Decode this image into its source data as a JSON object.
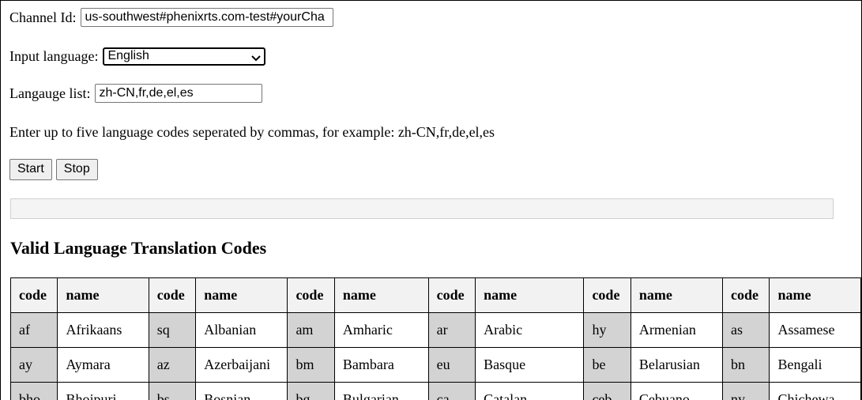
{
  "form": {
    "channel_label": "Channel Id:",
    "channel_value": "us-southwest#phenixrts.com-test#yourCha",
    "input_language_label": "Input language:",
    "input_language_selected": "English",
    "language_list_label": "Langauge list:",
    "language_list_value": "zh-CN,fr,de,el,es",
    "help_text": "Enter up to five language codes seperated by commas, for example: zh-CN,fr,de,el,es",
    "start_label": "Start",
    "stop_label": "Stop"
  },
  "section": {
    "title": "Valid Language Translation Codes"
  },
  "table": {
    "headers": [
      "code",
      "name",
      "code",
      "name",
      "code",
      "name",
      "code",
      "name",
      "code",
      "name",
      "code",
      "name"
    ],
    "rows": [
      [
        {
          "code": "af",
          "name": "Afrikaans"
        },
        {
          "code": "sq",
          "name": "Albanian"
        },
        {
          "code": "am",
          "name": "Amharic"
        },
        {
          "code": "ar",
          "name": "Arabic"
        },
        {
          "code": "hy",
          "name": "Armenian"
        },
        {
          "code": "as",
          "name": "Assamese"
        }
      ],
      [
        {
          "code": "ay",
          "name": "Aymara"
        },
        {
          "code": "az",
          "name": "Azerbaijani"
        },
        {
          "code": "bm",
          "name": "Bambara"
        },
        {
          "code": "eu",
          "name": "Basque"
        },
        {
          "code": "be",
          "name": "Belarusian"
        },
        {
          "code": "bn",
          "name": "Bengali"
        }
      ],
      [
        {
          "code": "bho",
          "name": "Bhojpuri"
        },
        {
          "code": "bs",
          "name": "Bosnian"
        },
        {
          "code": "bg",
          "name": "Bulgarian"
        },
        {
          "code": "ca",
          "name": "Catalan"
        },
        {
          "code": "ceb",
          "name": "Cebuano"
        },
        {
          "code": "ny",
          "name": "Chichewa"
        }
      ]
    ]
  }
}
